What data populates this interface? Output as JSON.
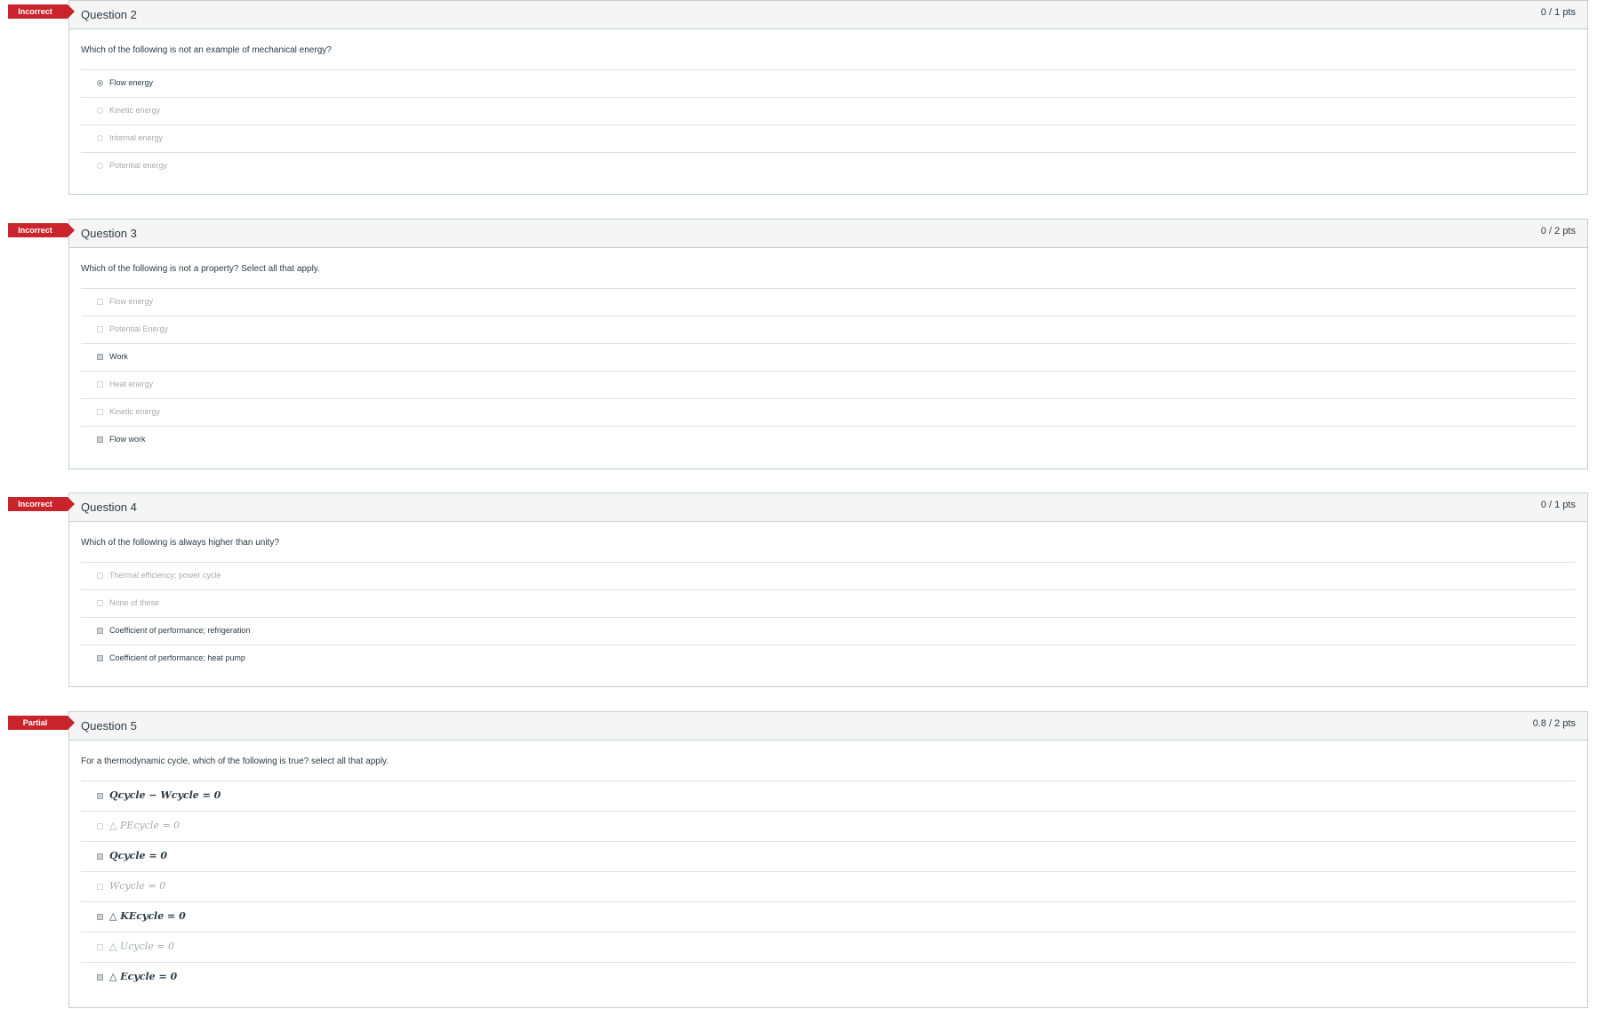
{
  "questions": [
    {
      "badge": "Incorrect",
      "title": "Question 2",
      "points": "0 / 1 pts",
      "text": "Which of the following is not an example of mechanical energy?",
      "answers": [
        {
          "label": "Flow energy",
          "selected": true
        },
        {
          "label": "Kinetic energy",
          "selected": false
        },
        {
          "label": "Internal energy",
          "selected": false
        },
        {
          "label": "Potential energy",
          "selected": false
        }
      ]
    },
    {
      "badge": "Incorrect",
      "title": "Question 3",
      "points": "0 / 2 pts",
      "text": "Which of the following is not a property? Select all that apply.",
      "answers": [
        {
          "label": "Flow energy",
          "selected": false
        },
        {
          "label": "Potential Energy",
          "selected": false
        },
        {
          "label": "Work",
          "selected": true
        },
        {
          "label": "Heat energy",
          "selected": false
        },
        {
          "label": "Kinetic energy",
          "selected": false
        },
        {
          "label": "Flow work",
          "selected": true
        }
      ]
    },
    {
      "badge": "Incorrect",
      "title": "Question 4",
      "points": "0 / 1 pts",
      "text": "Which of the following is always higher than unity?",
      "answers": [
        {
          "label": "Thermal efficiency; power cycle",
          "selected": false
        },
        {
          "label": "None of these",
          "selected": false
        },
        {
          "label": "Coefficient of performance; refrigeration",
          "selected": true
        },
        {
          "label": "Coefficient of performance; heat pump",
          "selected": true
        }
      ]
    },
    {
      "badge": "Partial",
      "title": "Question 5",
      "points": "0.8 / 2 pts",
      "text": "For a thermodynamic cycle, which of the following is true? select all that apply.",
      "answers": [
        {
          "label": "Qcycle − Wcycle = 0",
          "selected": true
        },
        {
          "label": "△ PEcycle = 0",
          "selected": false
        },
        {
          "label": "Qcycle = 0",
          "selected": true
        },
        {
          "label": "Wcycle = 0",
          "selected": false
        },
        {
          "label": "△ KEcycle = 0",
          "selected": true
        },
        {
          "label": "△ Ucycle = 0",
          "selected": false
        },
        {
          "label": "△ Ecycle = 0",
          "selected": true
        }
      ]
    }
  ]
}
